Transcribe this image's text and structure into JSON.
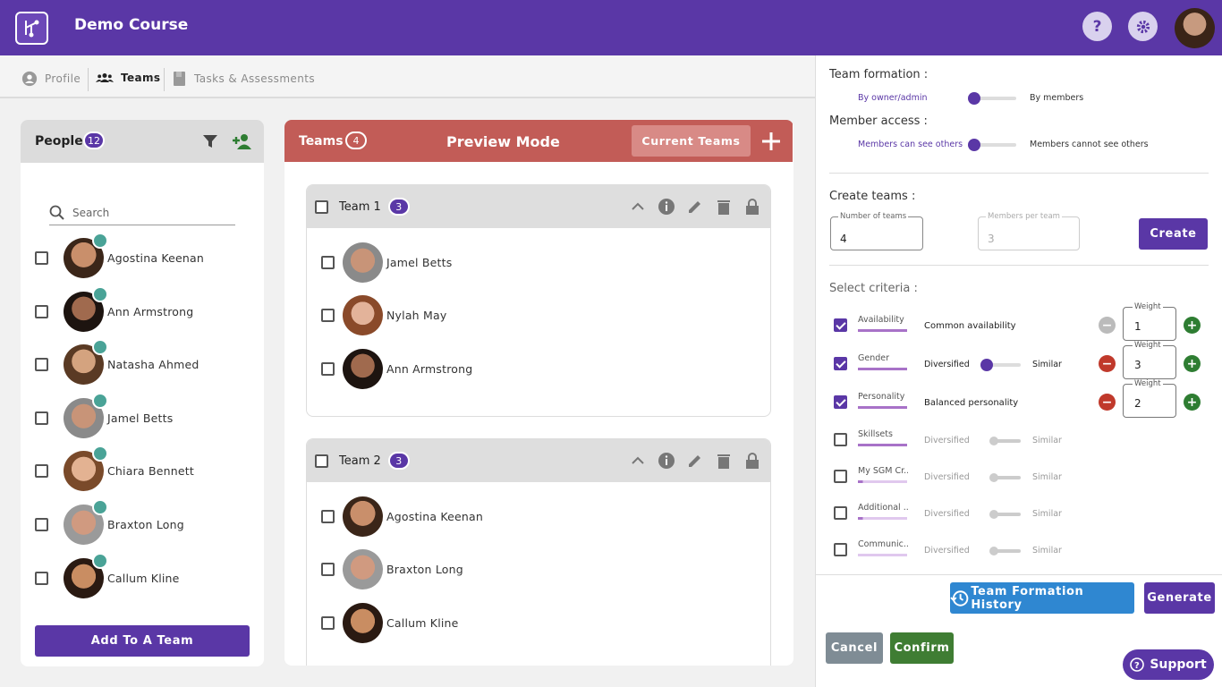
{
  "app": {
    "title": "Demo Course",
    "help_icon": "question-icon",
    "settings_icon": "gear-icon"
  },
  "tabs": [
    {
      "label": "Profile",
      "icon": "user-circle-icon"
    },
    {
      "label": "Teams",
      "icon": "group-icon"
    },
    {
      "label": "Tasks & Assessments",
      "icon": "book-icon"
    }
  ],
  "people": {
    "title": "People",
    "count": "12",
    "search_placeholder": "Search",
    "items": [
      {
        "name": "Agostina Keenan"
      },
      {
        "name": "Ann Armstrong"
      },
      {
        "name": "Natasha Ahmed"
      },
      {
        "name": "Jamel Betts"
      },
      {
        "name": "Chiara Bennett"
      },
      {
        "name": "Braxton Long"
      },
      {
        "name": "Callum Kline"
      }
    ],
    "add_button": "Add To A Team"
  },
  "teams": {
    "title": "Teams",
    "count": "4",
    "mode": "Preview Mode",
    "current_button": "Current Teams",
    "list": [
      {
        "name": "Team 1",
        "count": "3",
        "members": [
          "Jamel Betts",
          "Nylah May",
          "Ann Armstrong"
        ]
      },
      {
        "name": "Team 2",
        "count": "3",
        "members": [
          "Agostina Keenan",
          "Braxton Long",
          "Callum Kline"
        ]
      }
    ]
  },
  "settings": {
    "formation_label": "Team formation :",
    "formation_left": "By owner/admin",
    "formation_right": "By members",
    "access_label": "Member access :",
    "access_left": "Members can see others",
    "access_right": "Members cannot see others",
    "create_label": "Create teams :",
    "num_teams_label": "Number of teams",
    "num_teams_value": "4",
    "members_per_team_label": "Members per team",
    "members_per_team_placeholder": "3",
    "create_button": "Create",
    "criteria_label": "Select criteria :",
    "criteria": [
      {
        "name": "Availability",
        "checked": true,
        "desc": "Common availability",
        "weight": "1"
      },
      {
        "name": "Gender",
        "checked": true,
        "left": "Diversified",
        "right": "Similar",
        "weight": "3"
      },
      {
        "name": "Personality",
        "checked": true,
        "desc": "Balanced personality",
        "weight": "2"
      },
      {
        "name": "Skillsets",
        "checked": false,
        "left": "Diversified",
        "right": "Similar"
      },
      {
        "name": "My SGM Cr...",
        "checked": false,
        "left": "Diversified",
        "right": "Similar"
      },
      {
        "name": "Additional ...",
        "checked": false,
        "left": "Diversified",
        "right": "Similar"
      },
      {
        "name": "Communic...",
        "checked": false,
        "left": "Diversified",
        "right": "Similar"
      }
    ],
    "weight_label": "Weight",
    "history_button": "Team Formation History",
    "generate_button": "Generate",
    "cancel_button": "Cancel",
    "confirm_button": "Confirm",
    "support_button": "Support"
  },
  "colors": {
    "brand": "#5a37a6",
    "teams_header": "#c25c57",
    "confirm": "#3f7d33",
    "history": "#2f87d1"
  }
}
